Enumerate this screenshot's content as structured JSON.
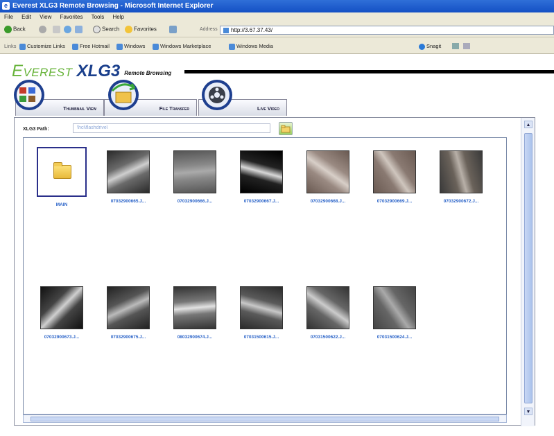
{
  "window": {
    "title": "Everest XLG3 Remote Browsing - Microsoft Internet Explorer",
    "menu": [
      "File",
      "Edit",
      "View",
      "Favorites",
      "Tools",
      "Help"
    ]
  },
  "toolbar": {
    "back_label": "Back",
    "search_label": "Search",
    "favorites_label": "Favorites",
    "address_label": "Address",
    "address_value": "http://3.67.37.43/"
  },
  "links_bar": {
    "label": "Links",
    "items": [
      "Customize Links",
      "Free Hotmail",
      "Windows",
      "Windows Marketplace",
      "Windows Media"
    ],
    "right_label": "Snagit"
  },
  "brand": {
    "everest": "Everest",
    "xlg3": "XLG3",
    "subtitle": "Remote Browsing"
  },
  "tabs": [
    {
      "label": "Thumbnail View"
    },
    {
      "label": "File Transfer"
    },
    {
      "label": "Live Video"
    }
  ],
  "path": {
    "label": "XLG3 Path:",
    "value": "\\hci\\flashdrive\\"
  },
  "files_row1": [
    {
      "label": "MAIN",
      "type": "folder"
    },
    {
      "label": "07032900665.J...",
      "type": "image",
      "tone": [
        "#2a2a2a",
        "#cfcfcf",
        "#6a6a6a"
      ]
    },
    {
      "label": "07032900666.J...",
      "type": "image",
      "tone": [
        "#555",
        "#aaa",
        "#888"
      ]
    },
    {
      "label": "07032900667.J...",
      "type": "image",
      "tone": [
        "#000",
        "#d8d8d8",
        "#222"
      ]
    },
    {
      "label": "07032900668.J...",
      "type": "image",
      "tone": [
        "#6a5a52",
        "#d8cfc8",
        "#9a8a82"
      ]
    },
    {
      "label": "07032900669.J...",
      "type": "image",
      "tone": [
        "#6a5a52",
        "#cfc6be",
        "#8a7a72"
      ]
    },
    {
      "label": "07032900672.J...",
      "type": "image",
      "tone": [
        "#3a3a3a",
        "#b8b0a8",
        "#6a625a"
      ]
    }
  ],
  "files_row2": [
    {
      "label": "07032900673.J...",
      "type": "image",
      "tone": [
        "#111",
        "#d0d0d0",
        "#444"
      ]
    },
    {
      "label": "07032900675.J...",
      "type": "image",
      "tone": [
        "#222",
        "#bbb",
        "#555"
      ]
    },
    {
      "label": "08032900674.J...",
      "type": "image",
      "tone": [
        "#333",
        "#e2e2e2",
        "#777"
      ]
    },
    {
      "label": "07031500615.J...",
      "type": "image",
      "tone": [
        "#2a2a2a",
        "#c8c8c8",
        "#5a5a5a"
      ]
    },
    {
      "label": "07031500622.J...",
      "type": "image",
      "tone": [
        "#333",
        "#ccc",
        "#666"
      ]
    },
    {
      "label": "07031500624.J...",
      "type": "image",
      "tone": [
        "#444",
        "#aaa",
        "#666"
      ]
    }
  ],
  "colors": {
    "brand_green": "#67b33a",
    "brand_blue": "#1a3f8c",
    "link_blue": "#2a63c8",
    "titlebar": "#1450c4"
  }
}
